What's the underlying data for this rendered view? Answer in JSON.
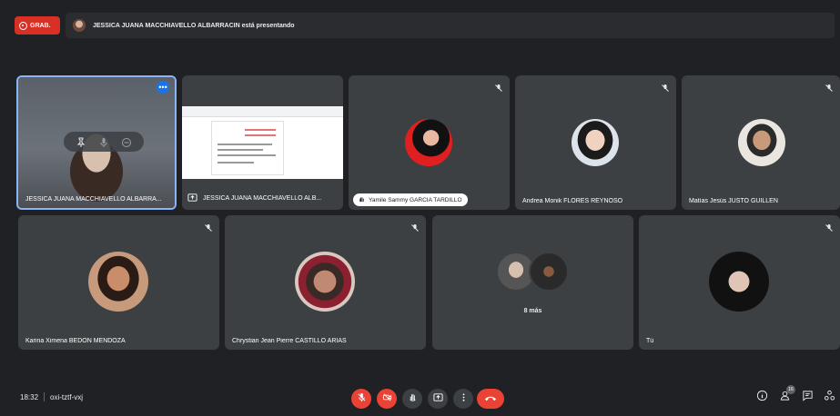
{
  "recording": {
    "label": "GRAB."
  },
  "presenting_banner": {
    "text": "JESSICA JUANA MACCHIAVELLO ALBARRACIN está presentando"
  },
  "tiles": {
    "main_video": {
      "name": "JESSICA JUANA MACCHIAVELLO ALBARRA..."
    },
    "presentation": {
      "name": "JESSICA JUANA MACCHIAVELLO ALB..."
    },
    "yamile": {
      "name": "Yamile Sammy GARCIA TARDILLO"
    },
    "andrea": {
      "name": "Andrea Monik FLORES REYNOSO"
    },
    "matias": {
      "name": "Matías Jesús JUSTO GUILLÉN"
    },
    "karina": {
      "name": "Karina Ximena BEDÓN MENDOZA"
    },
    "chrystian": {
      "name": "Chrystian Jean Pierre CASTILLO ARIAS"
    },
    "more": {
      "name": "8 más"
    },
    "self": {
      "name": "Tú"
    }
  },
  "bottom": {
    "time": "18:32",
    "meeting_code": "oxi-tztf-vxj",
    "participants_count": "16"
  },
  "colors": {
    "background": "#202124",
    "tile": "#3c4043",
    "accent": "#8ab4f8",
    "danger": "#ea4335"
  }
}
